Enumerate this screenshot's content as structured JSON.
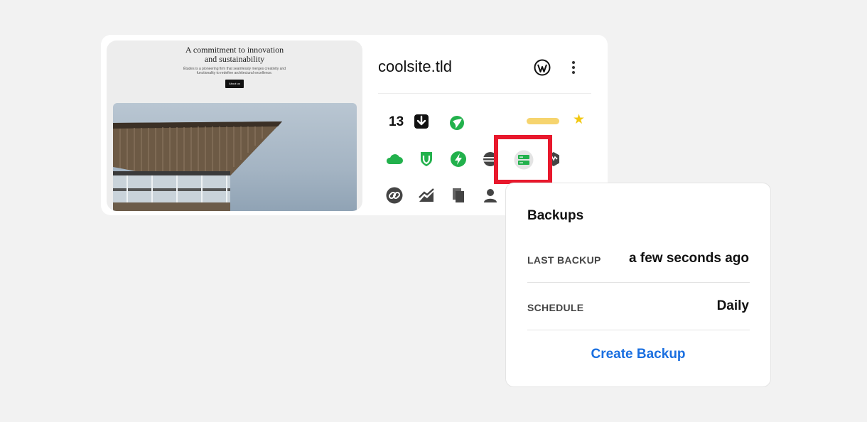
{
  "site_card": {
    "title": "coolsite.tld",
    "thumbnail": {
      "heading_line1": "A commitment to innovation",
      "heading_line2": "and sustainability",
      "body_line1": "Études is a pioneering firm that seamlessly merges creativity and",
      "body_line2": "functionality to redefine architectural excellence.",
      "button_label": "About us"
    },
    "updates_count": "13",
    "icons": {
      "header": [
        "wordpress-icon",
        "kebab-menu-icon"
      ],
      "row1": [
        "download-icon",
        "leaf-icon",
        "progress-pill",
        "star-icon"
      ],
      "row2": [
        "cloud-icon",
        "shield-icon",
        "bolt-icon",
        "globe-icon",
        "server-icon",
        "hexagon-icon"
      ],
      "row3": [
        "link-icon",
        "chart-icon",
        "copy-icon",
        "user-icon"
      ]
    },
    "colors": {
      "accent_green": "#22b14c",
      "icon_gray": "#444444",
      "star": "#f2c811",
      "pill": "#f6d46e",
      "highlight": "#e8182c"
    }
  },
  "backups_popover": {
    "title": "Backups",
    "rows": [
      {
        "label": "LAST BACKUP",
        "value": "a few seconds ago"
      },
      {
        "label": "SCHEDULE",
        "value": "Daily"
      }
    ],
    "action_label": "Create Backup",
    "action_color": "#1a6fe0"
  }
}
